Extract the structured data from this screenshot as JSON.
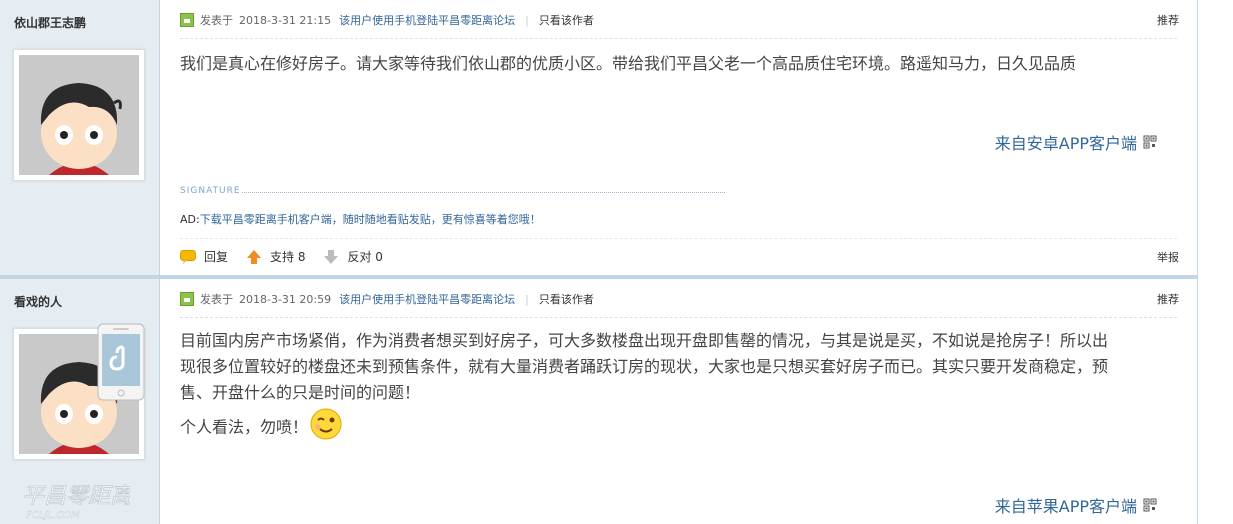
{
  "posts": [
    {
      "author": "依山郡王志鹏",
      "posted_prefix": "发表于",
      "posted_time": "2018-3-31 21:15",
      "device_note": "该用户使用手机登陆平昌零距离论坛",
      "only_author": "只看该作者",
      "recommend": "推荐",
      "content_lines": [
        "我们是真心在修好房子。请大家等待我们依山郡的优质小区。带给我们平昌父老一个高品质住宅环境。路遥知马力，日久见品质"
      ],
      "from_app": "来自安卓APP客户端",
      "signature_label": "SIGNATURE",
      "ad_label": "AD:",
      "ad_text": "下载平昌零距离手机客户端，随时随地看贴发贴，更有惊喜等着您哦！",
      "reply_label": "回复",
      "support_label": "支持 8",
      "oppose_label": "反对 0",
      "report_label": "举报"
    },
    {
      "author": "看戏的人",
      "posted_prefix": "发表于",
      "posted_time": "2018-3-31 20:59",
      "device_note": "该用户使用手机登陆平昌零距离论坛",
      "only_author": "只看该作者",
      "recommend": "推荐",
      "content_lines": [
        "目前国内房产市场紧俏，作为消费者想买到好房子，可大多数楼盘出现开盘即售罄的情况，与其是说是买，不如说是抢房子！所以出",
        "现很多位置较好的楼盘还未到预售条件，就有大量消费者踊跃订房的现状，大家也是只想买套好房子而已。其实只要开发商稳定，预",
        "售、开盘什么的只是时间的问题！"
      ],
      "content_tail": "个人看法，勿喷！",
      "from_app": "来自苹果APP客户端"
    }
  ],
  "watermark": {
    "main": "平昌零距离",
    "sub": "PCLJL.COM"
  },
  "colors": {
    "link": "#336699",
    "sidebar": "#e5edf2",
    "border": "#c2d5e3"
  }
}
